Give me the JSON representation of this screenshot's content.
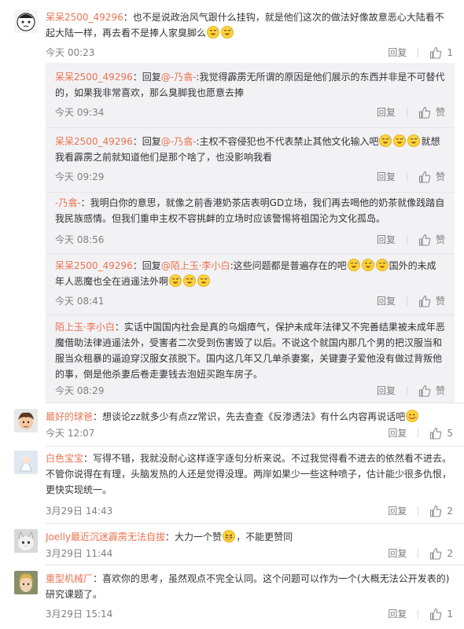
{
  "colors": {
    "username": "#eb7350",
    "meta": "#808080",
    "reply_bg": "#f2f2f5"
  },
  "comments": [
    {
      "user": "呆呆2500_49296",
      "text": "：也不是说政治风气跟什么挂钩，就是他们这次的做法好像故意恶心大陆看不起大陆一样，再去看不是捧人家臭脚么",
      "emojis": [
        "sweat-smile-emoji",
        "sweat-smile-emoji"
      ],
      "time": "今天 00:23",
      "reply_label": "回复",
      "likes": "1",
      "replies": [
        {
          "user": "呆呆2500_49296",
          "text": "：回复",
          "mention": "@-乃翕-",
          "text2": ":我觉得霹雳无所谓的原因是他们展示的东西并非是不可替代的，如果我非常喜欢，那么臭脚我也愿意去捧",
          "time": "今天 09:34",
          "reply_label": "回复",
          "like_label": "赞"
        },
        {
          "user": "呆呆2500_49296",
          "text": "：回复",
          "mention": "@-乃翕-",
          "text2": ":主权不容侵犯也不代表禁止其他文化输入吧",
          "text3": "就想我看霹雳之前就知道他们是那个啥了，也没影响我看",
          "time": "今天 09:29",
          "reply_label": "回复",
          "like_label": "赞"
        },
        {
          "user": "-乃翕-",
          "text": "：我明白你的意思，就像之前香港奶茶店表明GD立场，我们再去喝他的奶茶就像践踏自我民族感情。但我们重申主权不容挑衅的立场时应该警惕将祖国沦为文化孤岛。",
          "time": "今天 08:56",
          "reply_label": "回复",
          "like_label": "赞"
        },
        {
          "user": "呆呆2500_49296",
          "text": "：回复",
          "mention": "@陌上玉·李小白",
          "text2": ":这些问题都是普遍存在的吧",
          "text3": "国外的未成年人恶魔也全在逍遥法外啊",
          "time": "今天 08:41",
          "reply_label": "回复",
          "like_label": "赞"
        },
        {
          "user": "陌上玉·李小白",
          "text": "：实话中国国内社会是真的乌烟瘴气，保护未成年法律又不完善结果被未成年恶魔借助法律逍遥法外，受害者二次受到伤害毁了以后。不说这个就国内那几个男的把汉服当和服当众租暴的逼迫穿汉服女孩脱下。国内这几年又几单杀妻案，关键妻子爱他没有做过背叛他的事，倒是他杀妻后卷走妻钱去泡妞买跑车房子。",
          "time": "今天 08:29",
          "reply_label": "回复",
          "like_label": "赞"
        }
      ]
    },
    {
      "user": "最好的球爸",
      "text": "：想谈论zz就多少有点zz常识，先去查查《反渗透法》有什么内容再说话吧",
      "time": "今天 12:07",
      "reply_label": "回复",
      "likes": "5"
    },
    {
      "user": "白色宝宝",
      "text": "：写得不错，我就没耐心这样逐字逐句分析来说。不过我觉得看不进去的依然看不进去。不管你说得在有理，头脑发热的人还是觉得没理。两岸如果少一些这种喷子，估计能少很多仇恨，更快实现统一。",
      "time": "3月29日 14:43",
      "reply_label": "回复",
      "likes": "2"
    },
    {
      "user": "Joelly最近沉迷霹雳无法自拔",
      "text": "：大力一个赞",
      "text2": "，不能更赞同",
      "time": "3月29日 11:44",
      "reply_label": "回复",
      "likes": "2"
    },
    {
      "user": "重型机械厂",
      "text": "：喜欢你的思考，虽然观点不完全认同。这个问题可以作为一个(大概无法公开发表的)研究课题了。",
      "time": "3月29日 15:14",
      "reply_label": "回复",
      "likes": "1"
    }
  ]
}
